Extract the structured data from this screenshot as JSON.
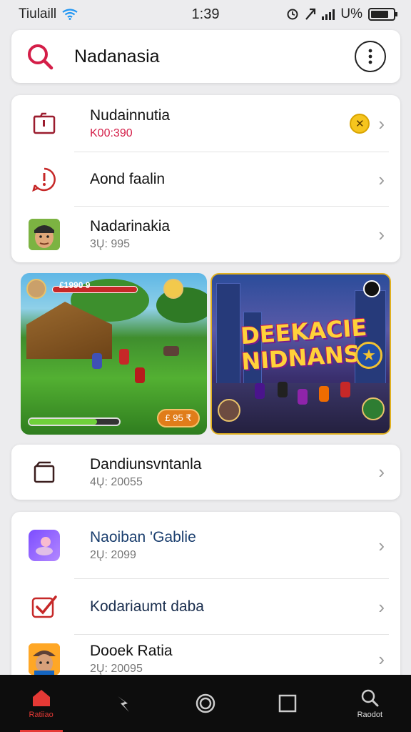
{
  "status_bar": {
    "carrier": "Tiulaill",
    "time": "1:39",
    "battery_text": "U%"
  },
  "search": {
    "title": "Nadanasia"
  },
  "list1": [
    {
      "label": "Nudainnutia",
      "sub": "K00:390",
      "sub_color": "#d41e48",
      "icon": "folder-icon",
      "badge": "coin-badge-icon"
    },
    {
      "label": "Aond faalin",
      "sub": "",
      "icon": "alert-circle-icon"
    },
    {
      "label": "Nadarinakia",
      "sub": "3Ų: 995",
      "icon": "avatar"
    }
  ],
  "banner_left": {
    "hud_text": "£1990 9",
    "coin_label": "£ 95 ₹"
  },
  "banner_right": {
    "title_line1": "DEEKACIE",
    "title_line2": "NIDNANS!"
  },
  "single_card": {
    "label": "Dandiunsvntanla",
    "sub": "4Ų: 20055"
  },
  "list2": [
    {
      "label": "Naoiban 'Gablie",
      "sub": "2Ų: 2099",
      "icon": "app-icon"
    },
    {
      "label": "Kodariaumt daba",
      "sub": "",
      "icon": "checkbox-icon"
    },
    {
      "label": "Dooek Ratia",
      "sub": "2Ų: 20095",
      "icon": "avatar"
    }
  ],
  "bottom_nav": [
    {
      "label": "Ratiiao",
      "icon": "home-icon",
      "active": true
    },
    {
      "label": "",
      "icon": "bolt-icon",
      "active": false
    },
    {
      "label": "",
      "icon": "circle-icon",
      "active": false
    },
    {
      "label": "",
      "icon": "square-icon",
      "active": false
    },
    {
      "label": "Raodot",
      "icon": "search-icon",
      "active": false
    }
  ],
  "colors": {
    "accent": "#e53935",
    "sub_red": "#d41e48",
    "nav_bg": "#0d0d0d"
  }
}
